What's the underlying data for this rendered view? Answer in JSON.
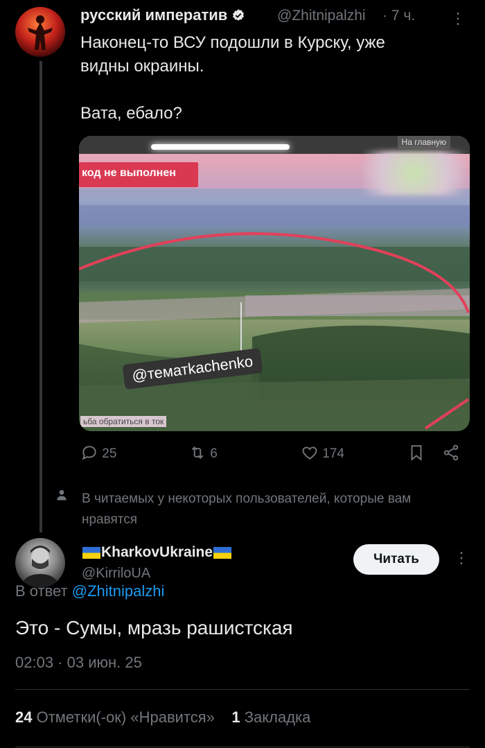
{
  "tweet1": {
    "author_name": "русский императив",
    "handle": "@Zhitnipalzhi",
    "time": "· 7 ч.",
    "more": "⋮",
    "text": "Наконец-то ВСУ подошли в Курску, уже\nвидны окраины.\n\nВата, ебало?",
    "media": {
      "red_box_text": "код не выполнен",
      "top_label": "На главную",
      "watermark": "@тематkachenko",
      "bottom_text": "ьба обратиться в ток"
    },
    "actions": {
      "replies": "25",
      "retweets": "6",
      "likes": "174"
    }
  },
  "social_context": "В читаемых у некоторых пользователей, которые вам нравятся",
  "tweet2": {
    "author_name": "KharkovUkraine",
    "handle": "@KirriloUA",
    "follow_label": "Читать",
    "more": "⋮",
    "reply_prefix": "В ответ",
    "reply_handle": "@Zhitnipalzhi",
    "text": "Это - Сумы, мразь рашистская",
    "meta": "02:03 · 03 июн. 25",
    "likes_count": "24",
    "likes_label": "Отметки(-ок) «Нравится»",
    "bookmarks_count": "1",
    "bookmarks_label": "Закладка"
  },
  "colors": {
    "accent": "#1d9bf0",
    "muted": "#71767b",
    "text": "#e7e9ea",
    "bg": "#000000"
  }
}
